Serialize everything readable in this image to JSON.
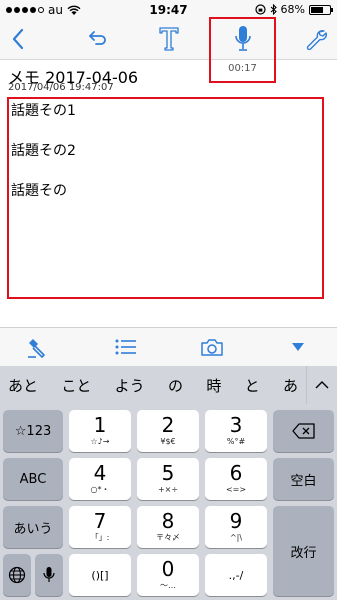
{
  "status_bar": {
    "carrier": "au",
    "time": "19:47",
    "battery": "68%",
    "battery_level": 0.68
  },
  "toolbar": {
    "back_icon": "chevron-left-icon",
    "undo_icon": "undo-icon",
    "text_icon": "text-format-icon",
    "mic_icon": "microphone-icon",
    "settings_icon": "wrench-icon",
    "recording_timer": "00:17"
  },
  "memo": {
    "title": "メモ 2017-04-06",
    "datetime": "2017/04/06 19:47:07",
    "lines": [
      "話題その1",
      "話題その2",
      "話題その"
    ]
  },
  "accessory_bar": {
    "icons": [
      "marker-icon",
      "list-icon",
      "camera-icon",
      "dropdown-triangle-icon"
    ]
  },
  "suggestions": [
    "あと",
    "こと",
    "よう",
    "の",
    "時",
    "と",
    "あ"
  ],
  "keyboard": {
    "left_column": [
      "☆123",
      "ABC",
      "あいう"
    ],
    "keys": [
      {
        "main": "1",
        "sub": "☆♪→"
      },
      {
        "main": "2",
        "sub": "¥$€"
      },
      {
        "main": "3",
        "sub": "%°#"
      },
      {
        "main": "4",
        "sub": "○*・"
      },
      {
        "main": "5",
        "sub": "+×÷"
      },
      {
        "main": "6",
        "sub": "<=>"
      },
      {
        "main": "7",
        "sub": "「」:"
      },
      {
        "main": "8",
        "sub": "〒々〆"
      },
      {
        "main": "9",
        "sub": "^|\\"
      },
      {
        "main": "0",
        "sub": "〜…"
      }
    ],
    "bracket_key": "()[]",
    "punct_key": ".,-/",
    "space_label": "空白",
    "return_label": "改行"
  },
  "colors": {
    "accent": "#2f7ed8",
    "highlight": "#e0101c",
    "keyboard_bg": "#d2d5db"
  }
}
